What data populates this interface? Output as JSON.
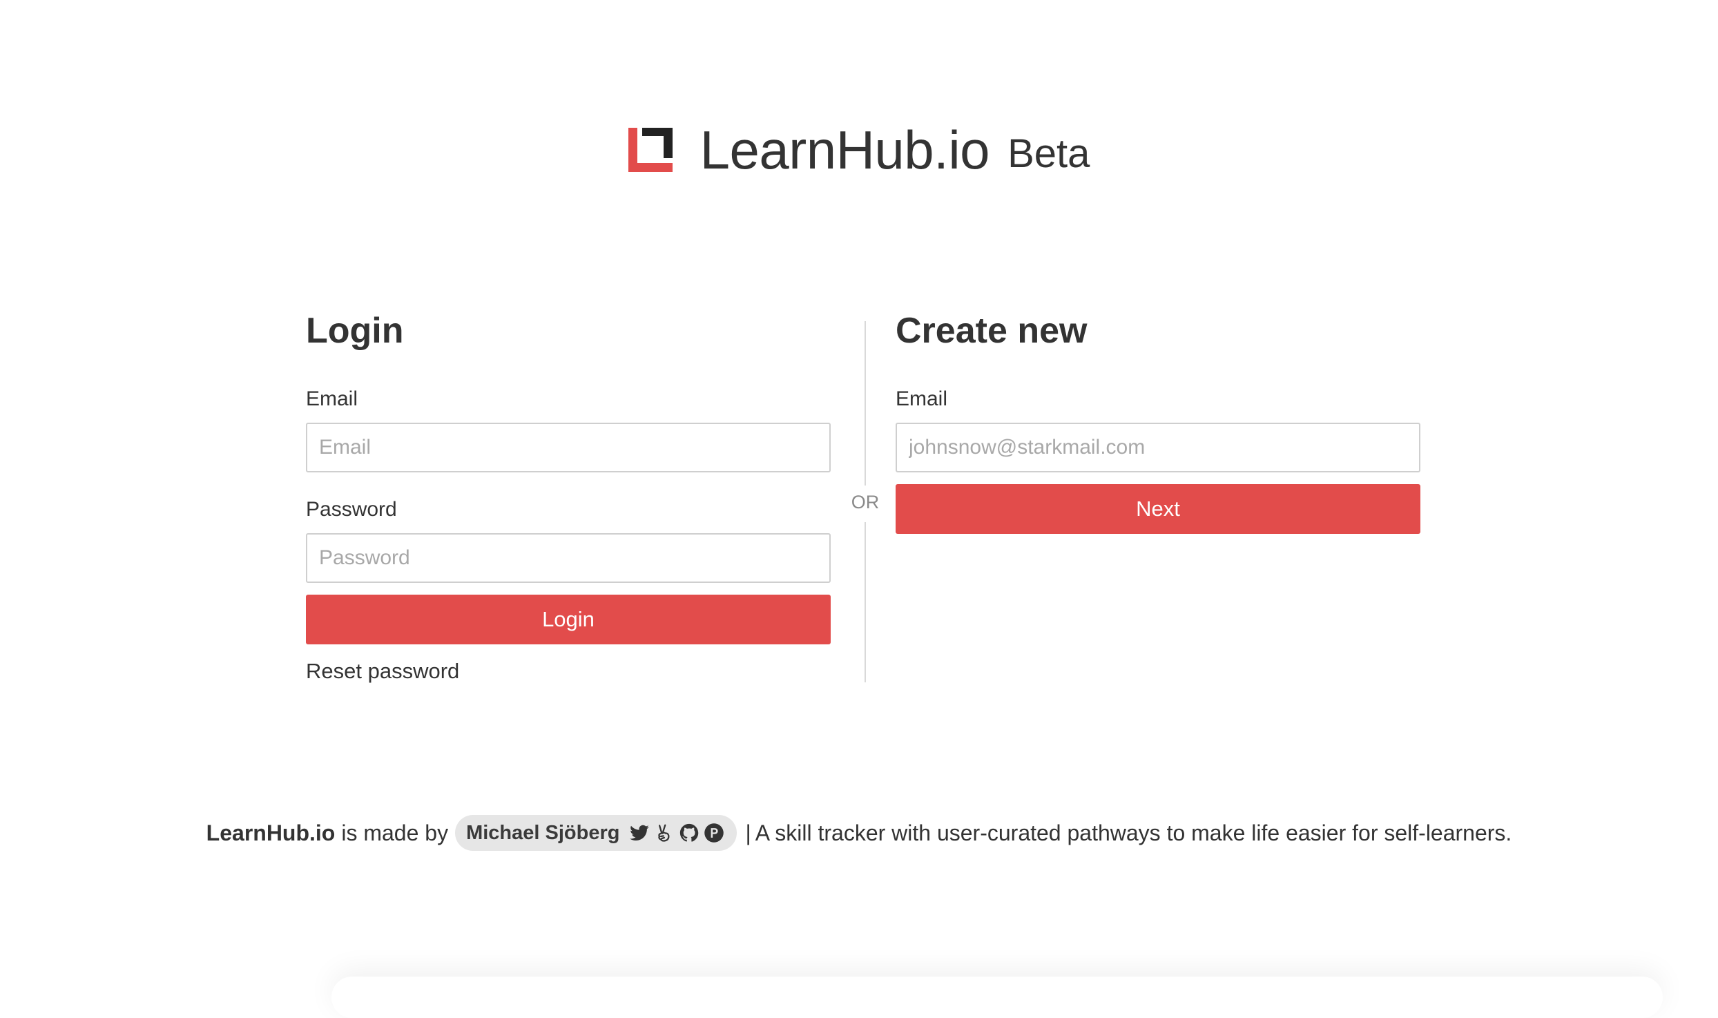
{
  "brand": {
    "name": "LearnHub.io",
    "badge": "Beta",
    "accent_color": "#e24c4b",
    "logo_icon": "learnhub-logo-icon"
  },
  "login": {
    "title": "Login",
    "email_label": "Email",
    "email_placeholder": "Email",
    "email_value": "",
    "password_label": "Password",
    "password_placeholder": "Password",
    "password_value": "",
    "submit_label": "Login",
    "reset_label": "Reset password"
  },
  "divider": {
    "label": "OR"
  },
  "create": {
    "title": "Create new",
    "email_label": "Email",
    "email_placeholder": "johnsnow@starkmail.com",
    "email_value": "",
    "submit_label": "Next"
  },
  "footer": {
    "brand": "LearnHub.io",
    "made_by": "is made by",
    "author": "Michael Sjöberg",
    "author_icons": [
      "twitter-icon",
      "victory-hand-icon",
      "github-icon",
      "patreon-icon"
    ],
    "separator": "|",
    "tagline": "A skill tracker with user-curated pathways to make life easier for self-learners."
  }
}
